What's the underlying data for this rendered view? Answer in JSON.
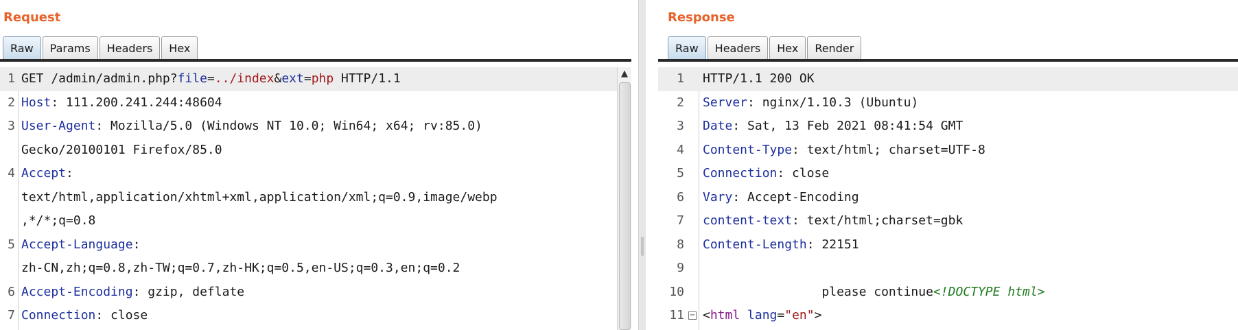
{
  "colors": {
    "title": "#e8632b",
    "key": "#1d2f9e",
    "value": "#a11a1a"
  },
  "request": {
    "title": "Request",
    "tabs": [
      "Raw",
      "Params",
      "Headers",
      "Hex"
    ],
    "active_tab": "Raw",
    "line_numbers": [
      "1",
      "2",
      "3",
      "",
      "4",
      "",
      "",
      "5",
      "",
      "6",
      "7"
    ],
    "line1": {
      "method": "GET /admin/admin.php?",
      "p1": "file",
      "eq1": "=",
      "v1": "../index",
      "amp": "&",
      "p2": "ext",
      "eq2": "=",
      "v2": "php",
      "proto": " HTTP/1.1"
    },
    "host": {
      "k": "Host",
      "v": ": 111.200.241.244:48604"
    },
    "ua": {
      "k": "User-Agent",
      "v": ": Mozilla/5.0 (Windows NT 10.0; Win64; x64; rv:85.0)",
      "cont": "Gecko/20100101 Firefox/85.0"
    },
    "accept": {
      "k": "Accept",
      "v": ":",
      "cont1": "text/html,application/xhtml+xml,application/xml;q=0.9,image/webp",
      "cont2": ",*/*;q=0.8"
    },
    "lang": {
      "k": "Accept-Language",
      "v": ":",
      "cont": "zh-CN,zh;q=0.8,zh-TW;q=0.7,zh-HK;q=0.5,en-US;q=0.3,en;q=0.2"
    },
    "enc": {
      "k": "Accept-Encoding",
      "v": ": gzip, deflate"
    },
    "conn": {
      "k": "Connection",
      "v": ": close"
    },
    "scroll_up": "▲"
  },
  "response": {
    "title": "Response",
    "tabs": [
      "Raw",
      "Headers",
      "Hex",
      "Render"
    ],
    "active_tab": "Raw",
    "line_numbers": [
      "1",
      "2",
      "3",
      "4",
      "5",
      "6",
      "7",
      "8",
      "9",
      "10",
      "11"
    ],
    "status": "HTTP/1.1 200 OK",
    "headers": [
      {
        "k": "Server",
        "v": ": nginx/1.10.3 (Ubuntu)"
      },
      {
        "k": "Date",
        "v": ": Sat, 13 Feb 2021 08:41:54 GMT"
      },
      {
        "k": "Content-Type",
        "v": ": text/html; charset=UTF-8"
      },
      {
        "k": "Connection",
        "v": ": close"
      },
      {
        "k": "Vary",
        "v": ": Accept-Encoding"
      },
      {
        "k": "content-text",
        "v": ": text/html;charset=gbk"
      },
      {
        "k": "Content-Length",
        "v": ": 22151"
      }
    ],
    "line10": {
      "text": "                please continue",
      "doctype": "<!DOCTYPE html>"
    },
    "line11": {
      "open": "<",
      "tag": "html",
      "sp": " ",
      "attr": "lang",
      "eq": "=",
      "str": "\"en\"",
      "close": ">"
    },
    "fold_icon": "−"
  }
}
